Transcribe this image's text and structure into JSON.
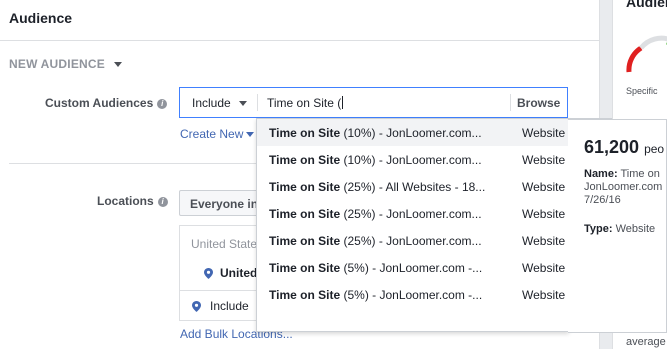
{
  "section": {
    "title": "Audience",
    "new_audience_label": "NEW AUDIENCE"
  },
  "custom_audiences": {
    "label": "Custom Audiences",
    "include_value": "Include",
    "input_value": "Time on Site (",
    "browse_label": "Browse",
    "create_new_label": "Create New"
  },
  "dropdown": {
    "items": [
      {
        "name_bold": "Time on Site",
        "name_rest": " (10%) - JonLoomer.com...",
        "type": "Website"
      },
      {
        "name_bold": "Time on Site",
        "name_rest": " (10%) - JonLoomer.com...",
        "type": "Website"
      },
      {
        "name_bold": "Time on Site",
        "name_rest": " (25%) - All Websites - 18...",
        "type": "Website"
      },
      {
        "name_bold": "Time on Site",
        "name_rest": " (25%) - JonLoomer.com...",
        "type": "Website"
      },
      {
        "name_bold": "Time on Site",
        "name_rest": " (25%) - JonLoomer.com...",
        "type": "Website"
      },
      {
        "name_bold": "Time on Site",
        "name_rest": " (5%) - JonLoomer.com -...",
        "type": "Website"
      },
      {
        "name_bold": "Time on Site",
        "name_rest": " (5%) - JonLoomer.com -...",
        "type": "Website"
      }
    ]
  },
  "detail": {
    "count": "61,200",
    "count_unit": "peo",
    "name_label": "Name:",
    "name_value": "Time on JonLoomer.com 7/26/16",
    "type_label": "Type:",
    "type_value": "Website"
  },
  "locations": {
    "label": "Locations",
    "selector_value": "Everyone in",
    "country": "United State",
    "item": "United",
    "include_label": "Include",
    "bulk_label": "Add Bulk Locations..."
  },
  "right_panel": {
    "title": "Audien",
    "specific_label": "Specific",
    "average_label": "average"
  },
  "colors": {
    "link": "#4267b2",
    "focus_border": "#4080ff",
    "gauge_red": "#e02020",
    "gauge_green": "#42b72a"
  }
}
